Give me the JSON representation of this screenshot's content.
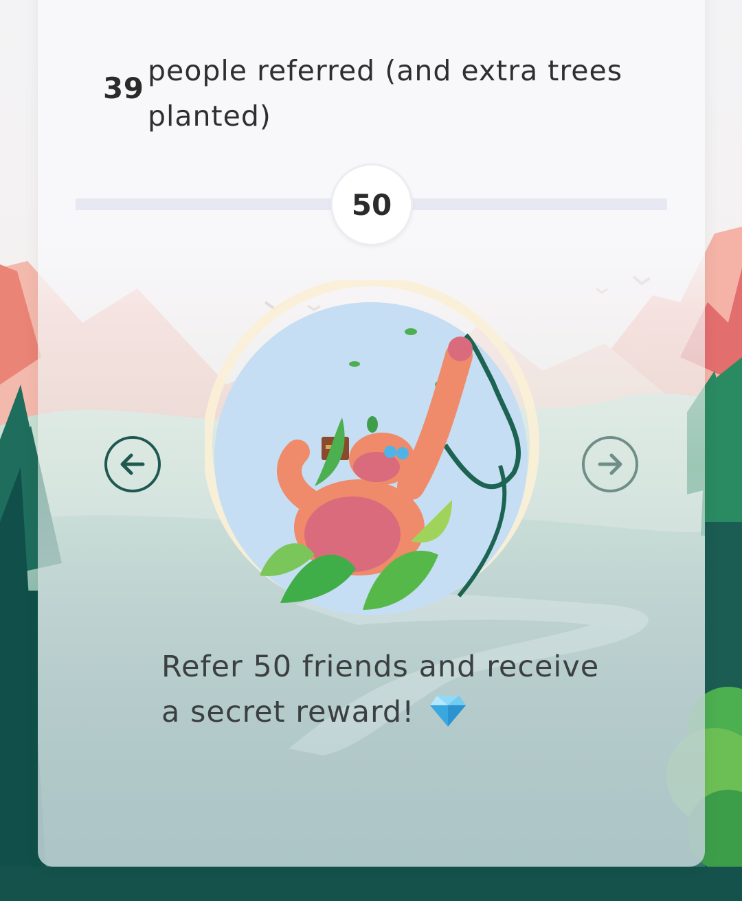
{
  "referral": {
    "count": "39",
    "label": "people referred (and extra trees planted)"
  },
  "progress": {
    "milestone_value": "50"
  },
  "reward": {
    "text": "Refer 50 friends and receive a secret reward!",
    "emoji_icon": "gem-icon"
  },
  "nav": {
    "prev_icon": "arrow-left-icon",
    "next_icon": "arrow-right-icon"
  },
  "colors": {
    "text_dark": "#2b2b2b",
    "arrow_dark": "#1e5850",
    "arrow_muted": "#6f8e88",
    "track": "#e7e8f2",
    "forest_dark": "#15524c",
    "mountain_pink": "#f0a79b"
  }
}
